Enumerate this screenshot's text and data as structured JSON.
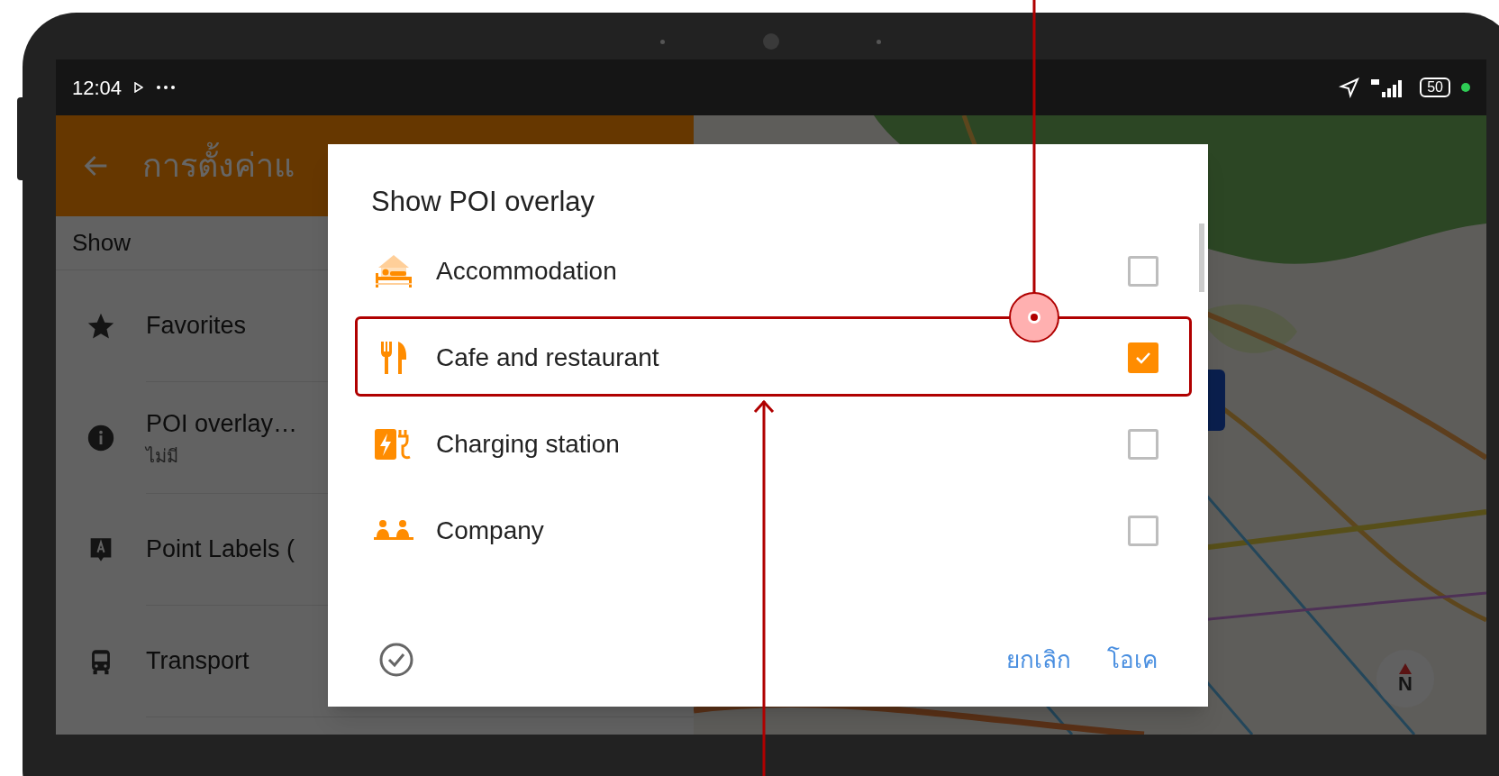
{
  "status_bar": {
    "time": "12:04",
    "battery": "50"
  },
  "app_bar": {
    "title": "การตั้งค่าแ"
  },
  "settings": {
    "section": "Show",
    "items": [
      {
        "kind": "star",
        "label": "Favorites"
      },
      {
        "kind": "info",
        "label": "POI overlay…",
        "subtitle": "ไม่มี"
      },
      {
        "kind": "label",
        "label": "Point Labels ("
      },
      {
        "kind": "bus",
        "label": "Transport"
      }
    ]
  },
  "dialog": {
    "title": "Show POI overlay",
    "options": [
      {
        "kind": "bed",
        "label": "Accommodation",
        "checked": false,
        "highlighted": false
      },
      {
        "kind": "utensils",
        "label": "Cafe and restaurant",
        "checked": true,
        "highlighted": true
      },
      {
        "kind": "charger",
        "label": "Charging station",
        "checked": false,
        "highlighted": false
      },
      {
        "kind": "people",
        "label": "Company",
        "checked": false,
        "highlighted": false
      }
    ],
    "buttons": [
      {
        "label": "ยกเลิก"
      },
      {
        "label": "โอเค"
      }
    ]
  },
  "compass": {
    "label": "N"
  }
}
